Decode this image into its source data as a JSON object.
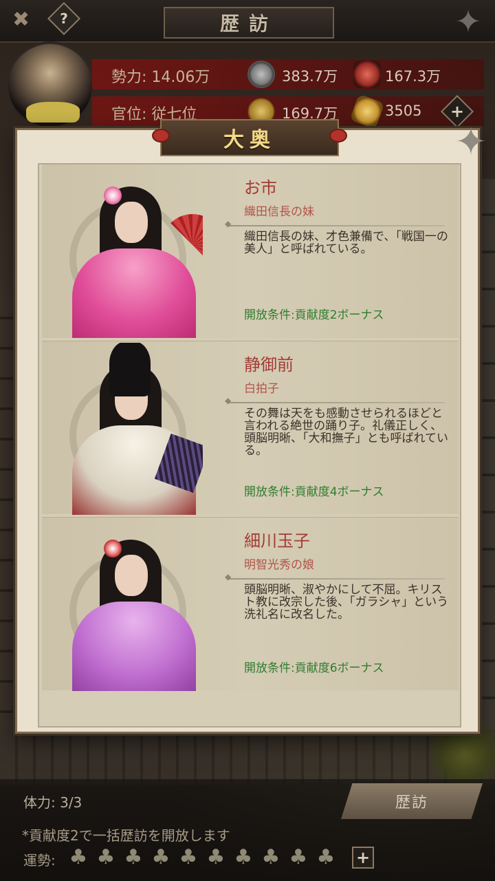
{
  "header": {
    "title": "歴訪",
    "help_label": "?",
    "back_icon": "back-icon",
    "corner_icon": "shuriken-icon"
  },
  "player": {
    "power_label": "勢力:",
    "power_value": "14.06万",
    "rank_label": "官位:",
    "rank_value": "従七位",
    "coins": "383.7万",
    "food": "167.3万",
    "rice": "169.7万",
    "tokens": "3505",
    "add_label": "+"
  },
  "modal": {
    "title": "大奥",
    "close_icon": "shuriken-close-icon",
    "cards": [
      {
        "name": "お市",
        "subtitle": "織田信長の妹",
        "description": "織田信長の妹、才色兼備で、「戦国一の美人」と呼ばれている。",
        "condition": "開放条件:貢献度2ボーナス"
      },
      {
        "name": "静御前",
        "subtitle": "白拍子",
        "description": "その舞は天をも感動させられるほどと言われる絶世の踊り子。礼儀正しく、頭脳明晰、「大和撫子」とも呼ばれている。",
        "condition": "開放条件:貢献度4ボーナス"
      },
      {
        "name": "細川玉子",
        "subtitle": "明智光秀の娘",
        "description": "頭脳明晰、淑やかにして不屈。キリスト教に改宗した後、「ガラシャ」という洗礼名に改名した。",
        "condition": "開放条件:貢献度6ボーナス"
      }
    ]
  },
  "footer": {
    "stamina": "体力: 3/3",
    "visit_button": "歴訪",
    "notice": "*貢献度2で一括歴訪を開放します",
    "luck_label": "運勢:",
    "luck_total": 10,
    "luck_filled": 0,
    "add_label": "+"
  },
  "colors": {
    "accent_red": "#a33b35",
    "condition_green": "#2f7d2e",
    "panel_bg": "#d6cdb6",
    "title_gold": "#f4d988"
  }
}
